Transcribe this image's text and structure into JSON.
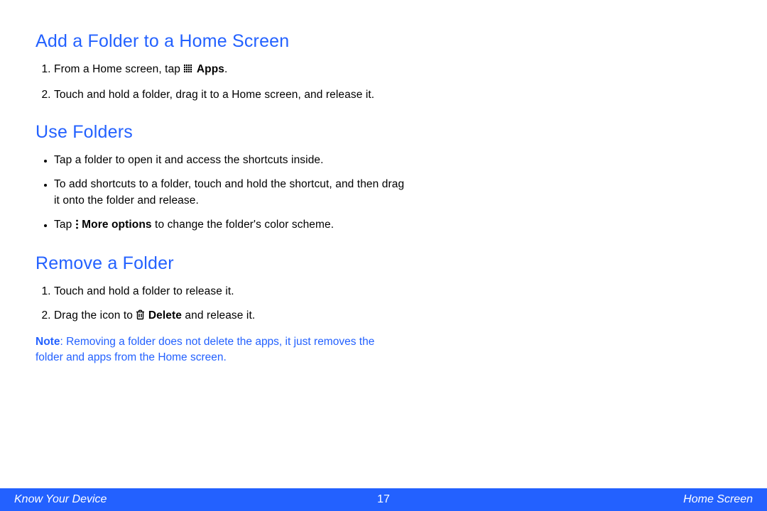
{
  "sections": {
    "addFolder": {
      "heading": "Add a Folder to a Home Screen",
      "steps": [
        {
          "pre": "From a Home screen, tap ",
          "icon": "apps",
          "bold": "Apps",
          "post": "."
        },
        {
          "pre": "Touch and hold a folder, drag it to a Home screen, and release it."
        }
      ]
    },
    "useFolders": {
      "heading": "Use Folders",
      "bullets": [
        {
          "pre": "Tap a folder to open it and access the shortcuts inside."
        },
        {
          "pre": "To add shortcuts to a folder, touch and hold the shortcut, and then drag it onto the folder and release."
        },
        {
          "pre": "Tap ",
          "icon": "more",
          "bold": "More options",
          "post": " to change the folder's color scheme."
        }
      ]
    },
    "removeFolder": {
      "heading": "Remove a Folder",
      "steps": [
        {
          "pre": "Touch and hold a folder to release it."
        },
        {
          "pre": "Drag the icon to ",
          "icon": "delete",
          "bold": "Delete",
          "post": " and release it."
        }
      ],
      "note": {
        "bold": "Note",
        "text": ": Removing a folder does not delete the apps, it just removes the folder and apps from the Home screen."
      }
    }
  },
  "footer": {
    "left": "Know Your Device",
    "center": "17",
    "right": "Home Screen"
  },
  "icons": {
    "apps": "apps-grid-icon",
    "more": "more-options-icon",
    "delete": "delete-trash-icon"
  }
}
